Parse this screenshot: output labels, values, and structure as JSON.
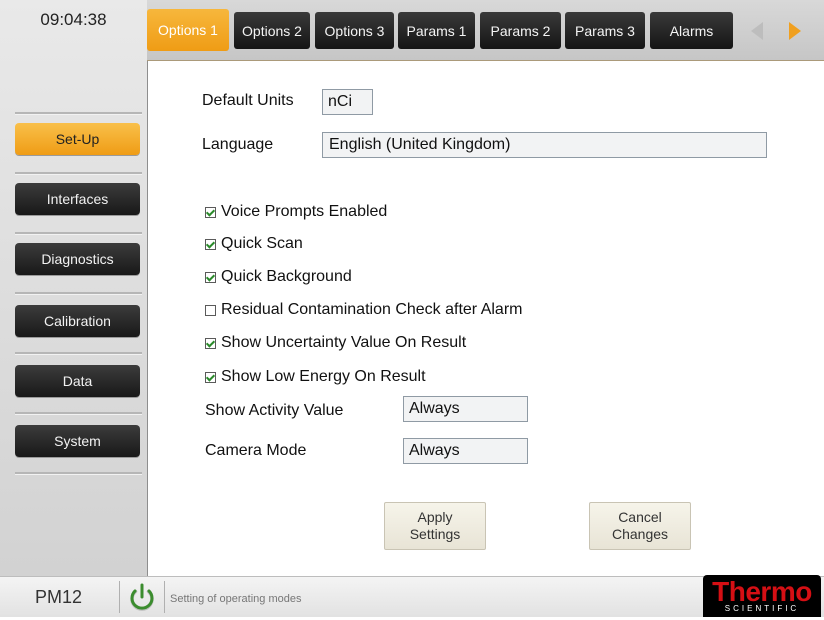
{
  "clock": "09:04:38",
  "sidebar": {
    "items": [
      {
        "label": "Set-Up",
        "active": true
      },
      {
        "label": "Interfaces",
        "active": false
      },
      {
        "label": "Diagnostics",
        "active": false
      },
      {
        "label": "Calibration",
        "active": false
      },
      {
        "label": "Data",
        "active": false
      },
      {
        "label": "System",
        "active": false
      }
    ]
  },
  "tabs": [
    {
      "label": "Options 1",
      "active": true
    },
    {
      "label": "Options 2",
      "active": false
    },
    {
      "label": "Options 3",
      "active": false
    },
    {
      "label": "Params 1",
      "active": false
    },
    {
      "label": "Params 2",
      "active": false
    },
    {
      "label": "Params 3",
      "active": false
    },
    {
      "label": "Alarms",
      "active": false
    }
  ],
  "tab_scroll": {
    "left_icon": "arrow-left-icon",
    "right_icon": "arrow-right-icon",
    "left_enabled": false,
    "right_enabled": true
  },
  "form": {
    "default_units_label": "Default Units",
    "default_units_value": "nCi",
    "language_label": "Language",
    "language_value": "English (United Kingdom)",
    "checkboxes": [
      {
        "label": "Voice Prompts Enabled",
        "checked": true
      },
      {
        "label": "Quick Scan",
        "checked": true
      },
      {
        "label": "Quick Background",
        "checked": true
      },
      {
        "label": "Residual Contamination Check after Alarm",
        "checked": false
      },
      {
        "label": "Show Uncertainty Value On Result",
        "checked": true
      },
      {
        "label": "Show Low Energy On Result",
        "checked": true
      }
    ],
    "show_activity_label": "Show Activity Value",
    "show_activity_value": "Always",
    "camera_mode_label": "Camera Mode",
    "camera_mode_value": "Always"
  },
  "buttons": {
    "apply": "Apply\nSettings",
    "cancel": "Cancel\nChanges"
  },
  "status": {
    "device": "PM12",
    "power_icon": "power-icon",
    "text": "Setting of operating modes"
  },
  "logo": {
    "main": "Thermo",
    "sub": "SCIENTIFIC"
  },
  "colors": {
    "accent": "#ef9c15",
    "dark_button": "#1e1e1e",
    "logo_red": "#d50f14"
  }
}
